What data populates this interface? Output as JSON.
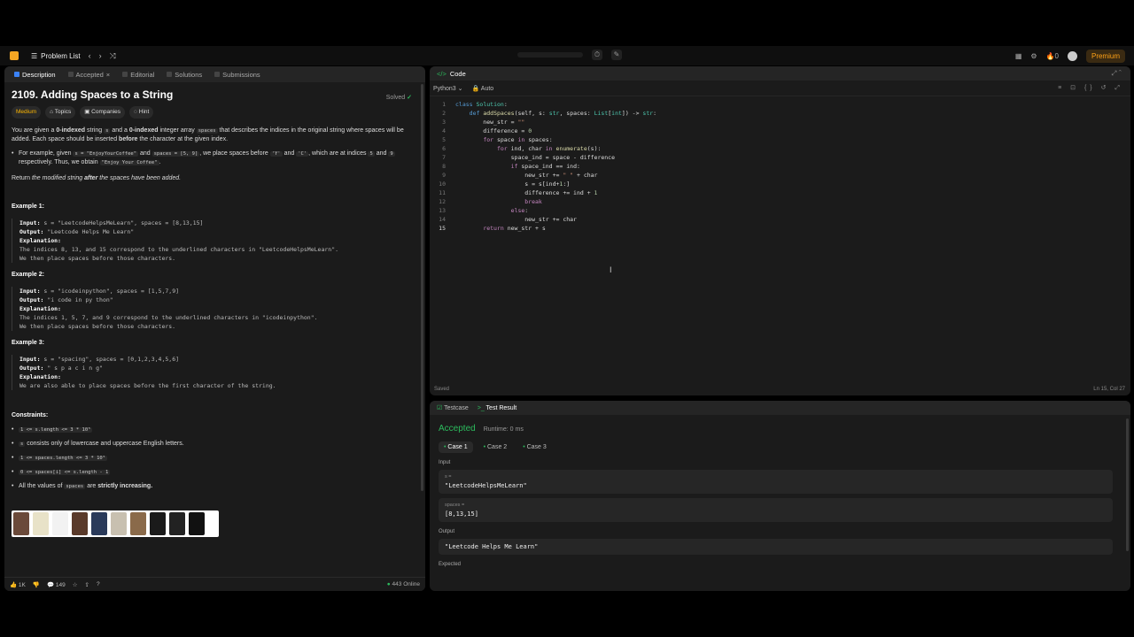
{
  "topnav": {
    "problem_list": "Problem List",
    "streak": "0",
    "premium": "Premium"
  },
  "left": {
    "tabs": [
      "Description",
      "Accepted",
      "Editorial",
      "Solutions",
      "Submissions"
    ],
    "title": "2109. Adding Spaces to a String",
    "solved": "Solved",
    "chips": [
      "Medium",
      "Topics",
      "Companies",
      "Hint"
    ],
    "p1_a": "You are given a",
    "p1_b": "0-indexed",
    "p1_c": "string",
    "p1_s": "s",
    "p1_d": "and a",
    "p1_e": "0-indexed",
    "p1_f": "integer array",
    "p1_spaces": "spaces",
    "p1_g": "that describes the indices in the original string where spaces will be added. Each space should be inserted",
    "p1_before": "before",
    "p1_h": "the character at the given index.",
    "b1_a": "For example, given",
    "b1_code1": "s = \"EnjoyYourCoffee\"",
    "b1_b": "and",
    "b1_code2": "spaces = [5, 9]",
    "b1_c": ", we place spaces before",
    "b1_y": "'Y'",
    "b1_d": "and",
    "b1_cc": "'C'",
    "b1_e": ", which are at indices",
    "b1_5": "5",
    "b1_f": "and",
    "b1_9": "9",
    "b1_g": "respectively. Thus, we obtain",
    "b1_code3": "\"Enjoy Your Coffee\"",
    "p2_a": "Return",
    "p2_b": "the modified string",
    "p2_c": "after",
    "p2_d": "the spaces have been added.",
    "examples": [
      {
        "title": "Example 1:",
        "input": "s = \"LeetcodeHelpsMeLearn\", spaces = [8,13,15]",
        "output": "\"Leetcode Helps Me Learn\"",
        "exp1": "The indices 8, 13, and 15 correspond to the underlined characters in \"LeetcodeHelpsMeLearn\".",
        "exp2": "We then place spaces before those characters."
      },
      {
        "title": "Example 2:",
        "input": "s = \"icodeinpython\", spaces = [1,5,7,9]",
        "output": "\"i code in py thon\"",
        "exp1": "The indices 1, 5, 7, and 9 correspond to the underlined characters in \"icodeinpython\".",
        "exp2": "We then place spaces before those characters."
      },
      {
        "title": "Example 3:",
        "input": "s = \"spacing\", spaces = [0,1,2,3,4,5,6]",
        "output": "\" s p a c i n g\"",
        "exp1": "We are also able to place spaces before the first character of the string.",
        "exp2": ""
      }
    ],
    "labels": {
      "input": "Input:",
      "output": "Output:",
      "explanation": "Explanation:"
    },
    "constraints_title": "Constraints:",
    "c1": "1 <= s.length <= 3 * 10⁵",
    "c2_code": "s",
    "c2_text": "consists only of lowercase and uppercase English letters.",
    "c3": "1 <= spaces.length <= 3 * 10⁵",
    "c4": "0 <= spaces[i] <= s.length - 1",
    "c5_a": "All the values of",
    "c5_code": "spaces",
    "c5_b": "are",
    "c5_c": "strictly increasing.",
    "footer": {
      "likes": "1K",
      "comments": "149",
      "online": "443 Online"
    }
  },
  "code": {
    "header": "Code",
    "language": "Python3",
    "mode": "Auto",
    "status": "Saved",
    "position": "Ln 15, Col 27"
  },
  "test": {
    "tabs": [
      "Testcase",
      "Test Result"
    ],
    "result": "Accepted",
    "runtime": "Runtime: 0 ms",
    "cases": [
      "Case 1",
      "Case 2",
      "Case 3"
    ],
    "input_label": "Input",
    "var1": "s =",
    "val1": "\"LeetcodeHelpsMeLearn\"",
    "var2": "spaces =",
    "val2": "[8,13,15]",
    "output_label": "Output",
    "output_val": "\"Leetcode Helps Me Learn\"",
    "expected_label": "Expected"
  }
}
